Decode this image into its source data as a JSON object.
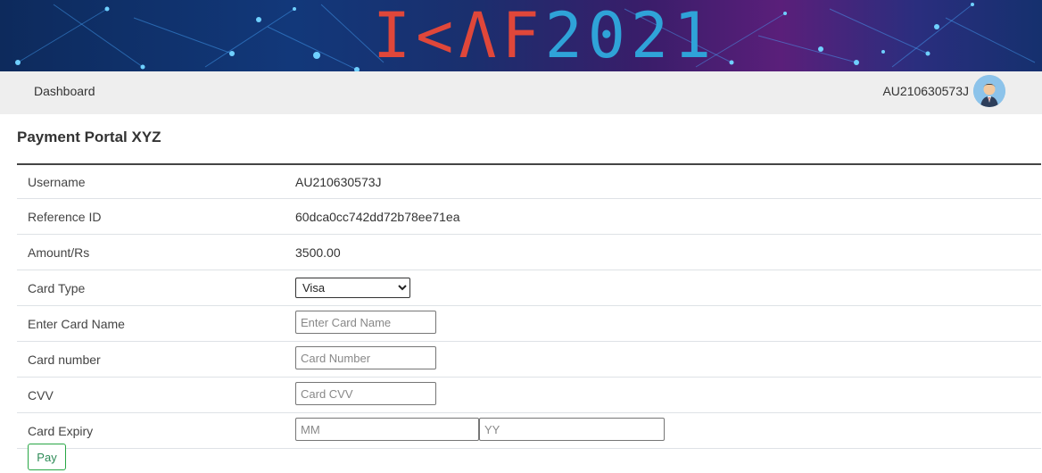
{
  "banner": {
    "logo_text_red": "I<ΛF",
    "logo_text_blue": "2021"
  },
  "navbar": {
    "brand": "Dashboard",
    "username": "AU210630573J"
  },
  "page": {
    "title": "Payment Portal XYZ"
  },
  "form": {
    "rows": [
      {
        "label": "Username",
        "value": "AU210630573J"
      },
      {
        "label": "Reference ID",
        "value": "60dca0cc742dd72b78ee71ea"
      },
      {
        "label": "Amount/Rs",
        "value": "3500.00"
      },
      {
        "label": "Card Type",
        "selected": "Visa"
      },
      {
        "label": "Enter Card Name",
        "placeholder": "Enter Card Name",
        "value": ""
      },
      {
        "label": "Card number",
        "placeholder": "Card Number",
        "value": ""
      },
      {
        "label": "CVV",
        "placeholder": "Card CVV",
        "value": ""
      },
      {
        "label": "Card Expiry",
        "placeholder_month": "MM",
        "placeholder_year": "YY"
      }
    ],
    "pay_label": "Pay"
  },
  "colors": {
    "navbar_bg": "#eeeeee",
    "logo_red": "#e0473a",
    "logo_blue": "#2fa3d8",
    "pay_button": "#28a745"
  }
}
